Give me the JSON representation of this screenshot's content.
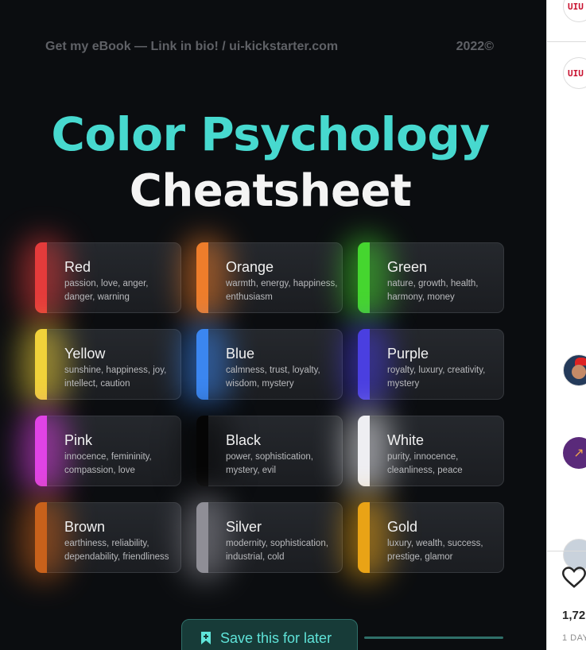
{
  "post": {
    "header_left": "Get my eBook — Link in bio! / ui-kickstarter.com",
    "header_right": "2022©",
    "title_line1": "Color Psychology",
    "title_line2": "Cheatsheet",
    "save_label": "Save this for later",
    "cards": [
      {
        "name": "Red",
        "desc": "passion, love, anger, danger, warning",
        "color": "#e43b3b"
      },
      {
        "name": "Orange",
        "desc": "warmth, energy, happiness, enthusiasm",
        "color": "#ee7d2b"
      },
      {
        "name": "Green",
        "desc": "nature, growth, health, harmony, money",
        "color": "#45d62f"
      },
      {
        "name": "Yellow",
        "desc": "sunshine, happiness, joy, intellect, caution",
        "color": "#f0d23a"
      },
      {
        "name": "Blue",
        "desc": "calmness, trust, loyalty, wisdom, mystery",
        "color": "#3b86f0"
      },
      {
        "name": "Purple",
        "desc": "royalty, luxury, creativity, mystery",
        "color": "#4a3fe0"
      },
      {
        "name": "Pink",
        "desc": "innocence, femininity, compassion, love",
        "color": "#e043e6"
      },
      {
        "name": "Black",
        "desc": "power, sophistication, mystery, evil",
        "color": "#050505"
      },
      {
        "name": "White",
        "desc": "purity, innocence, cleanliness, peace",
        "color": "#eeeef2"
      },
      {
        "name": "Brown",
        "desc": "earthiness, reliability, dependability, friendliness",
        "color": "#c8611b"
      },
      {
        "name": "Silver",
        "desc": "modernity, sophistication, industrial, cold",
        "color": "#8f8e96"
      },
      {
        "name": "Gold",
        "desc": "luxury, wealth, success, prestige, glamor",
        "color": "#e9a316"
      }
    ]
  },
  "sidebar": {
    "likes": "1,72",
    "age": "1 DAY"
  },
  "colors": {
    "accent": "#47d9cf",
    "background": "#0b0d10"
  }
}
